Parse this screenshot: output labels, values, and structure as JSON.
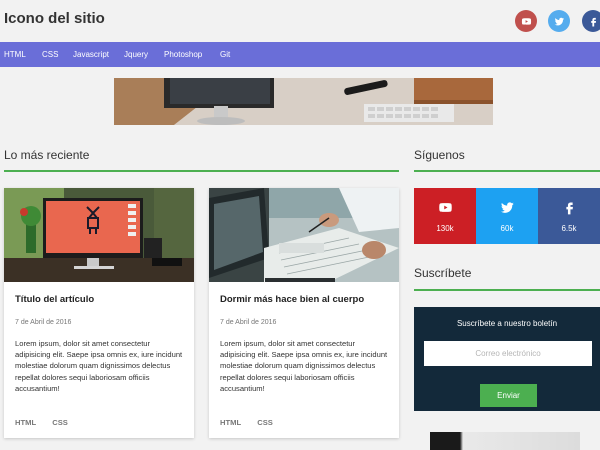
{
  "header": {
    "site_title": "Icono del sitio",
    "social": [
      {
        "icon": "youtube-icon",
        "color": "#c0504d"
      },
      {
        "icon": "twitter-icon",
        "color": "#55acee"
      },
      {
        "icon": "facebook-icon",
        "color": "#3b5998"
      }
    ]
  },
  "nav": {
    "items": [
      "HTML",
      "CSS",
      "Javascript",
      "Jquery",
      "Photoshop",
      "Git"
    ],
    "color": "#6a6ed8"
  },
  "sections": {
    "latest": "Lo más reciente",
    "follow": "Síguenos",
    "subscribe": "Suscríbete"
  },
  "articles": [
    {
      "title": "Título del artículo",
      "date": "7 de Abril de 2016",
      "body": "Lorem ipsum, dolor sit amet consectetur adipisicing elit. Saepe ipsa omnis ex, iure incidunt molestiae dolorum quam dignissimos delectus repellat dolores sequi laboriosam officiis accusantium!",
      "tags": [
        "HTML",
        "CSS"
      ]
    },
    {
      "title": "Dormir más hace bien al cuerpo",
      "date": "7 de Abril de 2016",
      "body": "Lorem ipsum, dolor sit amet consectetur adipisicing elit. Saepe ipsa omnis ex, iure incidunt molestiae dolorum quam dignissimos delectus repellat dolores sequi laboriosam officiis accusantium!",
      "tags": [
        "HTML",
        "CSS"
      ]
    }
  ],
  "follow": [
    {
      "icon": "youtube-icon",
      "count": "130k",
      "color": "#cc1f25"
    },
    {
      "icon": "twitter-icon",
      "count": "60k",
      "color": "#1da1f2"
    },
    {
      "icon": "facebook-icon",
      "count": "6.5k",
      "color": "#3b5998"
    }
  ],
  "subscribe": {
    "title": "Suscríbete a nuestro boletín",
    "placeholder": "Correo electrónico",
    "button": "Enviar"
  },
  "accent": "#4caf50"
}
